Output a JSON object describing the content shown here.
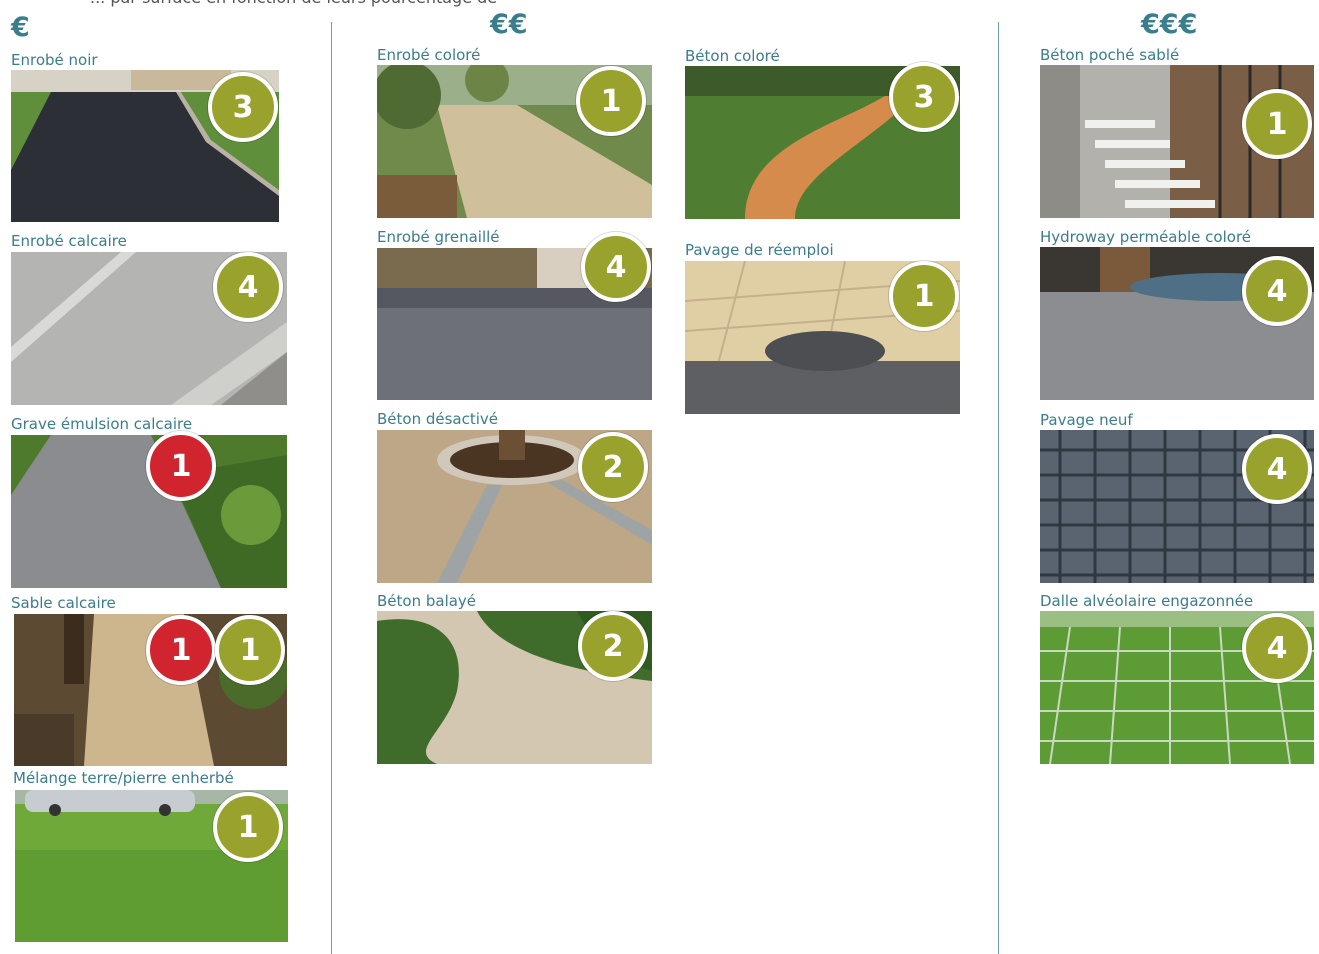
{
  "cut_text": "... par surface en fonction de leurs pourcentage de surface perméable et de leurs prix approximatifs (€)",
  "colors": {
    "accent": "#3a7d8c",
    "green_badge": "#98a22c",
    "red_badge": "#d0242f"
  },
  "columns": [
    {
      "price": "€"
    },
    {
      "price": "€€"
    },
    {
      "price": "€€€"
    }
  ],
  "items": [
    {
      "label": "Enrobé noir",
      "badges": [
        {
          "value": "3",
          "color": "green"
        }
      ],
      "photo": "asphalt"
    },
    {
      "label": "Enrobé calcaire",
      "badges": [
        {
          "value": "4",
          "color": "green"
        }
      ],
      "photo": "road-light"
    },
    {
      "label": "Grave émulsion calcaire",
      "badges": [
        {
          "value": "1",
          "color": "red"
        }
      ],
      "photo": "path-grass"
    },
    {
      "label": "Sable calcaire",
      "badges": [
        {
          "value": "1",
          "color": "red"
        },
        {
          "value": "1",
          "color": "green"
        }
      ],
      "photo": "sand-path"
    },
    {
      "label": "Mélange terre/pierre enherbé",
      "badges": [
        {
          "value": "1",
          "color": "green"
        }
      ],
      "photo": "lawn"
    },
    {
      "label": "Enrobé coloré",
      "badges": [
        {
          "value": "1",
          "color": "green"
        }
      ],
      "photo": "olive-path"
    },
    {
      "label": "Enrobé grenaillé",
      "badges": [
        {
          "value": "4",
          "color": "green"
        }
      ],
      "photo": "grey-drive"
    },
    {
      "label": "Béton désactivé",
      "badges": [
        {
          "value": "2",
          "color": "green"
        }
      ],
      "photo": "gravel-tree"
    },
    {
      "label": "Béton balayé",
      "badges": [
        {
          "value": "2",
          "color": "green"
        }
      ],
      "photo": "curved-path"
    },
    {
      "label": "Béton coloré",
      "badges": [
        {
          "value": "3",
          "color": "green"
        }
      ],
      "photo": "orange-path"
    },
    {
      "label": "Pavage de réemploi",
      "badges": [
        {
          "value": "1",
          "color": "green"
        }
      ],
      "photo": "cobble-light"
    },
    {
      "label": "Béton poché sablé",
      "badges": [
        {
          "value": "1",
          "color": "green"
        }
      ],
      "photo": "striped"
    },
    {
      "label": "Hydroway perméable coloré",
      "badges": [
        {
          "value": "4",
          "color": "green"
        }
      ],
      "photo": "grey-plaza"
    },
    {
      "label": "Pavage neuf",
      "badges": [
        {
          "value": "4",
          "color": "green"
        }
      ],
      "photo": "pavers"
    },
    {
      "label": "Dalle alvéolaire engazonnée",
      "badges": [
        {
          "value": "4",
          "color": "green"
        }
      ],
      "photo": "grass-grid"
    }
  ]
}
